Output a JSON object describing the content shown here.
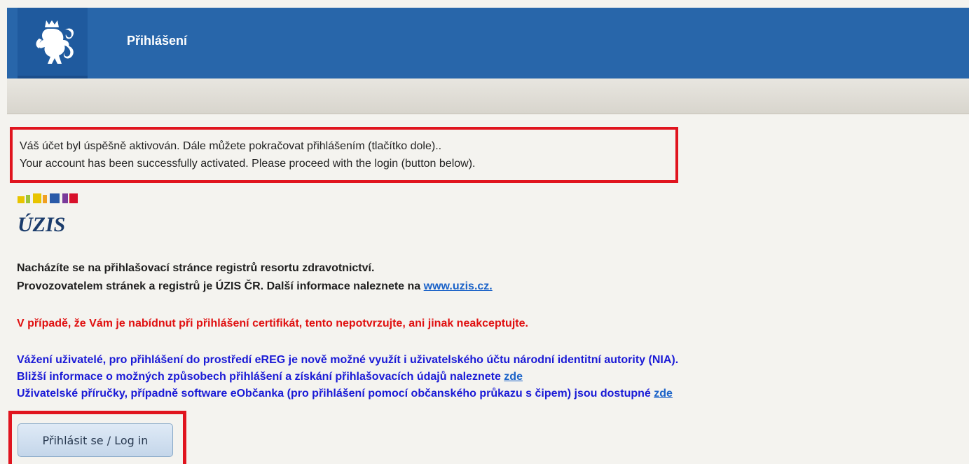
{
  "header": {
    "title": "Přihlášení"
  },
  "notice": {
    "line_cz": "Váš účet byl úspěšně aktivován. Dále můžete pokračovat přihlášením (tlačítko dole)..",
    "line_en": "Your account has been successfully activated. Please proceed with the login (button below)."
  },
  "logo": {
    "text": "ÚZIS"
  },
  "info": {
    "line1": "Nacházíte se na přihlašovací stránce registrů resortu zdravotnictví.",
    "line2_prefix": "Provozovatelem stránek a registrů je ÚZIS ČR. Další informace naleznete na ",
    "line2_link": "www.uzis.cz.",
    "warning": "V případě, že Vám je nabídnut při přihlášení certifikát, tento nepotvrzujte, ani jinak neakceptujte.",
    "nia_line": "Vážení uživatelé, pro přihlášení do prostředí eREG je nově možné využít i uživatelského účtu národní identitní autority (NIA).",
    "detail_prefix": "Bližší informace o možných způsobech přihlášení a získání přihlašovacích údajů naleznete ",
    "detail_link": "zde",
    "manual_prefix": "Uživatelské příručky, případně software eObčanka (pro přihlášení pomocí občanského průkazu s čipem) jsou dostupné ",
    "manual_link": "zde"
  },
  "login_button": {
    "label": "Přihlásit se / Log in"
  },
  "colors": {
    "header_blue": "#2866aa",
    "highlight_red": "#e0141e",
    "warning_red": "#e01010",
    "info_blue": "#1a1ad6",
    "link_blue": "#1a62c8"
  }
}
